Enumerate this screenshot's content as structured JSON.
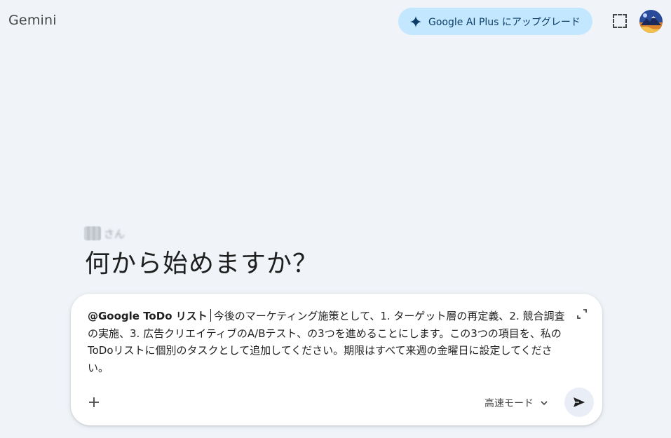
{
  "header": {
    "app_title": "Gemini",
    "upgrade_label": "Google AI Plus にアップグレード"
  },
  "greeting": {
    "user_name": "さん",
    "title": "何から始めますか？"
  },
  "composer": {
    "mention": "@Google ToDo リスト",
    "prompt": "今後のマーケティング施策として、1. ターゲット層の再定義、2. 競合調査の実施、3. 広告クリエイティブのA/Bテスト、の3つを進めることにします。この3つの項目を、私のToDoリストに個別のタスクとして追加してください。期限はすべて来週の金曜日に設定してください。",
    "mode_label": "高速モード"
  },
  "icons": {
    "spark": "sparkle-icon",
    "select": "screen-select-icon",
    "expand": "expand-icon",
    "add": "plus-icon",
    "dropdown": "chevron-down-icon",
    "send": "send-icon"
  },
  "colors": {
    "background": "#f0f4f9",
    "upgrade_bg": "#c2e7ff",
    "upgrade_text": "#0b3d66",
    "card_bg": "#ffffff",
    "send_bg": "#e9eef6"
  }
}
